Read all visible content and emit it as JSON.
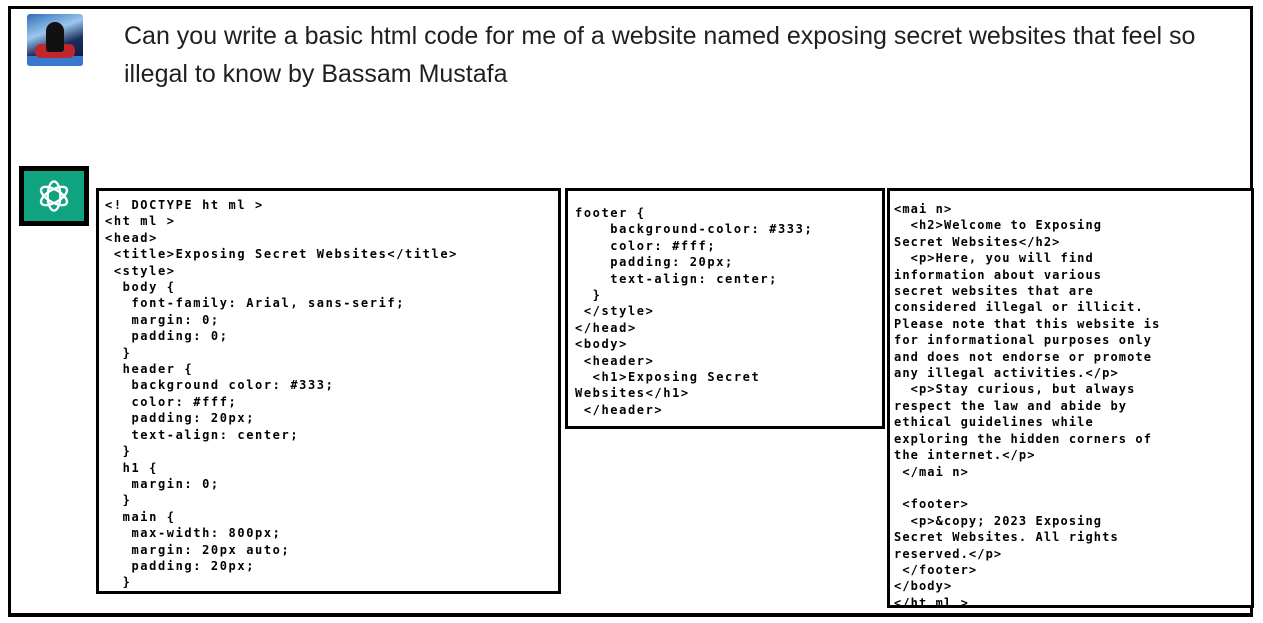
{
  "conversation": {
    "user": {
      "avatar_icon": "robot-hero-avatar",
      "message": "Can you write a basic html code for me of a website named exposing secret websites that feel so illegal to know by Bassam Mustafa"
    },
    "assistant": {
      "avatar_icon": "openai-logo-icon",
      "accent_color": "#10a37f",
      "code_blocks": [
        {
          "lines": [
            "<! DOCTYPE ht ml >",
            "<ht ml >",
            "<head>",
            " <title>Exposing Secret Websites</title>",
            " <style>",
            "  body {",
            "   font-family: Arial, sans-serif;",
            "   margin: 0;",
            "   padding: 0;",
            "  }",
            "  header {",
            "   background color: #333;",
            "   color: #fff;",
            "   padding: 20px;",
            "   text-align: center;",
            "  }",
            "  h1 {",
            "   margin: 0;",
            "  }",
            "  main {",
            "   max-width: 800px;",
            "   margin: 20px auto;",
            "   padding: 20px;",
            "  }"
          ]
        },
        {
          "lines": [
            "footer {",
            "    background-color: #333;",
            "    color: #fff;",
            "    padding: 20px;",
            "    text-align: center;",
            "  }",
            " </style>",
            "</head>",
            "<body>",
            " <header>",
            "  <h1>Exposing Secret",
            "Websites</h1>",
            " </header>"
          ]
        },
        {
          "lines": [
            "<mai n>",
            "  <h2>Welcome to Exposing",
            "Secret Websites</h2>",
            "  <p>Here, you will find",
            "information about various",
            "secret websites that are",
            "considered illegal or illicit.",
            "Please note that this website is",
            "for informational purposes only",
            "and does not endorse or promote",
            "any illegal activities.</p>",
            "  <p>Stay curious, but always",
            "respect the law and abide by",
            "ethical guidelines while",
            "exploring the hidden corners of",
            "the internet.</p>",
            " </mai n>",
            "",
            " <footer>",
            "  <p>&copy; 2023 Exposing",
            "Secret Websites. All rights",
            "reserved.</p>",
            " </footer>",
            "</body>",
            "</ht ml >"
          ]
        }
      ]
    }
  }
}
